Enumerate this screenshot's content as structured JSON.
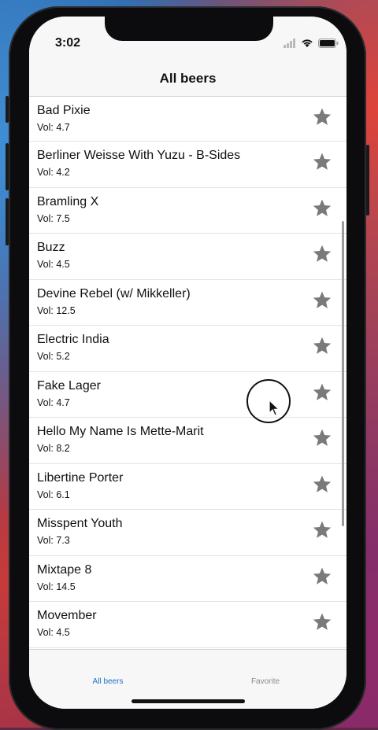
{
  "status_bar": {
    "time": "3:02"
  },
  "nav": {
    "title": "All beers"
  },
  "beers": [
    {
      "name": "Bad Pixie",
      "vol": "Vol: 4.7"
    },
    {
      "name": "Berliner Weisse With Yuzu - B-Sides",
      "vol": "Vol: 4.2"
    },
    {
      "name": "Bramling X",
      "vol": "Vol: 7.5"
    },
    {
      "name": "Buzz",
      "vol": "Vol: 4.5"
    },
    {
      "name": "Devine Rebel (w/ Mikkeller)",
      "vol": "Vol: 12.5"
    },
    {
      "name": "Electric India",
      "vol": "Vol: 5.2"
    },
    {
      "name": "Fake Lager",
      "vol": "Vol: 4.7"
    },
    {
      "name": "Hello My Name Is Mette-Marit",
      "vol": "Vol: 8.2"
    },
    {
      "name": "Libertine Porter",
      "vol": "Vol: 6.1"
    },
    {
      "name": "Misspent Youth",
      "vol": "Vol: 7.3"
    },
    {
      "name": "Mixtape 8",
      "vol": "Vol: 14.5"
    },
    {
      "name": "Movember",
      "vol": "Vol: 4.5"
    }
  ],
  "row_icon": "star-icon",
  "tabs": [
    {
      "label": "All beers",
      "active": true
    },
    {
      "label": "Favorite",
      "active": false
    }
  ],
  "colors": {
    "accent": "#1a73c9",
    "star": "#7a7a7a",
    "inactive_tab": "#8a8a8a"
  }
}
